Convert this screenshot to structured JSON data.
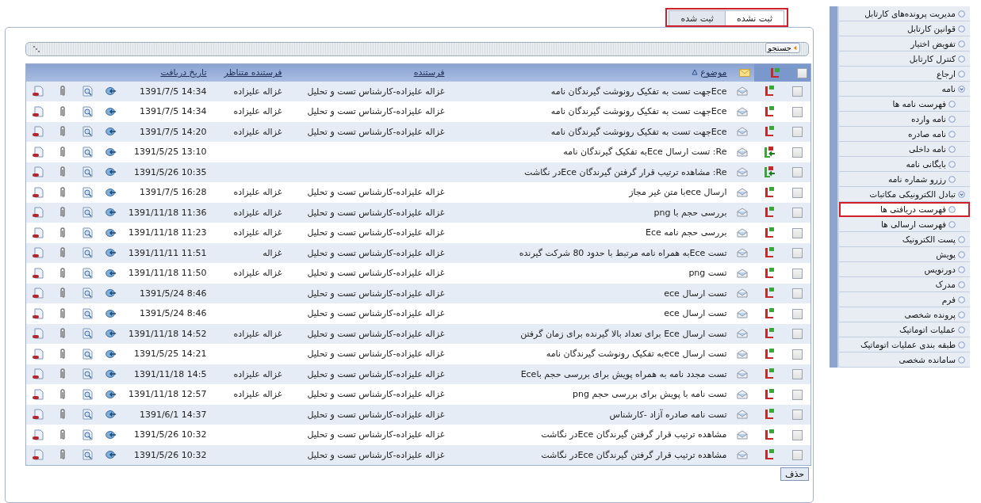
{
  "tabs": [
    {
      "label": "ثبت نشده",
      "selected": true
    },
    {
      "label": "ثبت شده",
      "selected": false
    }
  ],
  "search": {
    "label": "جستجو",
    "expanded": false
  },
  "table": {
    "select_all_checked": false,
    "columns": [
      "موضوع",
      "فرستنده",
      "فرستنده متناظر",
      "تاریخ دریافت"
    ],
    "rows": [
      {
        "kind": "normal",
        "checked": false,
        "subject": "Eceجهت تست به تفکیک رونوشت گیرندگان نامه",
        "sender": "غزاله علیزاده-کارشناس تست و تحلیل",
        "counterpart": "غزاله علیزاده",
        "date": "1391/7/5 14:34"
      },
      {
        "kind": "normal",
        "checked": false,
        "subject": "Eceجهت تست به تفکیک رونوشت گیرندگان نامه",
        "sender": "غزاله علیزاده-کارشناس تست و تحلیل",
        "counterpart": "غزاله علیزاده",
        "date": "1391/7/5 14:34"
      },
      {
        "kind": "normal",
        "checked": false,
        "subject": "Eceجهت تست به تفکیک رونوشت گیرندگان نامه",
        "sender": "غزاله علیزاده-کارشناس تست و تحلیل",
        "counterpart": "غزاله علیزاده",
        "date": "1391/7/5 14:20"
      },
      {
        "kind": "reply",
        "checked": false,
        "subject": "Re: تست ارسال Eceبه تفکیک گیرندگان نامه",
        "date": "1391/5/25 13:10"
      },
      {
        "kind": "reply",
        "checked": false,
        "subject": "Re: مشاهده ترتیب قرار گرفتن گیرندگان Eceدر نگاشت",
        "date": "1391/5/26 10:35"
      },
      {
        "kind": "normal",
        "checked": false,
        "subject": "ارسال eceبا متن غیر مجاز",
        "sender": "غزاله علیزاده-کارشناس تست و تحلیل",
        "counterpart": "غزاله علیزاده",
        "date": "1391/7/5 16:28"
      },
      {
        "kind": "normal",
        "checked": false,
        "subject": "بررسی حجم با png",
        "sender": "غزاله علیزاده-کارشناس تست و تحلیل",
        "counterpart": "غزاله علیزاده",
        "date": "1391/11/18 11:36"
      },
      {
        "kind": "normal",
        "checked": false,
        "subject": "بررسی حجم نامه Ece",
        "sender": "غزاله علیزاده-کارشناس تست و تحلیل",
        "counterpart": "غزاله علیزاده",
        "date": "1391/11/18 11:23"
      },
      {
        "kind": "normal",
        "checked": false,
        "subject": "تست Eceبه همراه نامه مرتبط با حدود 80 شرکت گیرنده",
        "sender": "غزاله علیزاده-کارشناس تست و تحلیل",
        "counterpart": "غزاله",
        "date": "1391/11/11 11:51"
      },
      {
        "kind": "normal",
        "checked": false,
        "subject": "تست png",
        "sender": "غزاله علیزاده-کارشناس تست و تحلیل",
        "counterpart": "غزاله علیزاده",
        "date": "1391/11/18 11:50"
      },
      {
        "kind": "normal",
        "checked": false,
        "subject": "تست ارسال ece",
        "sender": "غزاله علیزاده-کارشناس تست و تحلیل",
        "date": "1391/5/24 8:46"
      },
      {
        "kind": "normal",
        "checked": false,
        "subject": "تست ارسال ece",
        "sender": "غزاله علیزاده-کارشناس تست و تحلیل",
        "date": "1391/5/24 8:46"
      },
      {
        "kind": "normal",
        "checked": false,
        "subject": "تست ارسال Ece برای تعداد بالا گیرنده برای زمان گرفتن",
        "sender": "غزاله علیزاده-کارشناس تست و تحلیل",
        "counterpart": "غزاله علیزاده",
        "date": "1391/11/18 14:52"
      },
      {
        "kind": "normal",
        "checked": false,
        "subject": "تست ارسال eceبه تفکیک رونوشت گیرندگان نامه",
        "sender": "غزاله علیزاده-کارشناس تست و تحلیل",
        "date": "1391/5/25 14:21"
      },
      {
        "kind": "normal",
        "checked": false,
        "subject": "تست مجدد نامه به همراه پویش برای بررسی حجم باEce",
        "sender": "غزاله علیزاده-کارشناس تست و تحلیل",
        "counterpart": "غزاله علیزاده",
        "date": "1391/11/18 14:5"
      },
      {
        "kind": "normal",
        "checked": false,
        "subject": "تست نامه با پویش برای بررسی حجم png",
        "sender": "غزاله علیزاده-کارشناس تست و تحلیل",
        "counterpart": "غزاله علیزاده",
        "date": "1391/11/18 12:57"
      },
      {
        "kind": "normal",
        "checked": false,
        "subject": "تست نامه صادره آزاد -کارشناس",
        "sender": "غزاله علیزاده-کارشناس تست و تحلیل",
        "date": "1391/6/1 14:37"
      },
      {
        "kind": "normal",
        "checked": false,
        "subject": "مشاهده ترتیب قرار گرفتن گیرندگان Eceدر نگاشت",
        "sender": "غزاله علیزاده-کارشناس تست و تحلیل",
        "date": "1391/5/26 10:32"
      },
      {
        "kind": "normal",
        "checked": false,
        "subject": "مشاهده ترتیب قرار گرفتن گیرندگان Eceدر نگاشت",
        "sender": "غزاله علیزاده-کارشناس تست و تحلیل",
        "date": "1391/5/26 10:32"
      }
    ]
  },
  "delete_button": "حذف",
  "sidebar": {
    "items": [
      {
        "label": "مدیریت پرونده‌های کارتابل",
        "selected": false
      },
      {
        "label": "قوانین کارتابل",
        "selected": false
      },
      {
        "label": "تفویض اختیار",
        "selected": false
      },
      {
        "label": "کنترل کارتابل",
        "selected": false
      },
      {
        "label": "ارجاع",
        "selected": false
      },
      {
        "label": "نامه",
        "selected": false,
        "expanded": true,
        "children": [
          {
            "label": "فهرست نامه ها",
            "selected": false
          },
          {
            "label": "نامه وارده",
            "selected": false
          },
          {
            "label": "نامه صادره",
            "selected": false
          },
          {
            "label": "نامه داخلی",
            "selected": false
          },
          {
            "label": "بایگانی نامه",
            "selected": false
          },
          {
            "label": "رزرو شماره نامه",
            "selected": false
          }
        ]
      },
      {
        "label": "تبادل الکترونیکی مکاتبات",
        "selected": false,
        "expanded": true,
        "children": [
          {
            "label": "فهرست دریافتی ها",
            "selected": true
          },
          {
            "label": "فهرست ارسالی ها",
            "selected": false
          }
        ]
      },
      {
        "label": "پست الکترونیک",
        "selected": false
      },
      {
        "label": "پویش",
        "selected": false
      },
      {
        "label": "دورنویس",
        "selected": false
      },
      {
        "label": "مدرک",
        "selected": false
      },
      {
        "label": "فرم",
        "selected": false
      },
      {
        "label": "پرونده شخصی",
        "selected": false
      },
      {
        "label": "عملیات اتوماتیک",
        "selected": false
      },
      {
        "label": "طبقه بندی عملیات اتوماتیک",
        "selected": false
      },
      {
        "label": "سامانده شخصی",
        "selected": false
      }
    ]
  }
}
